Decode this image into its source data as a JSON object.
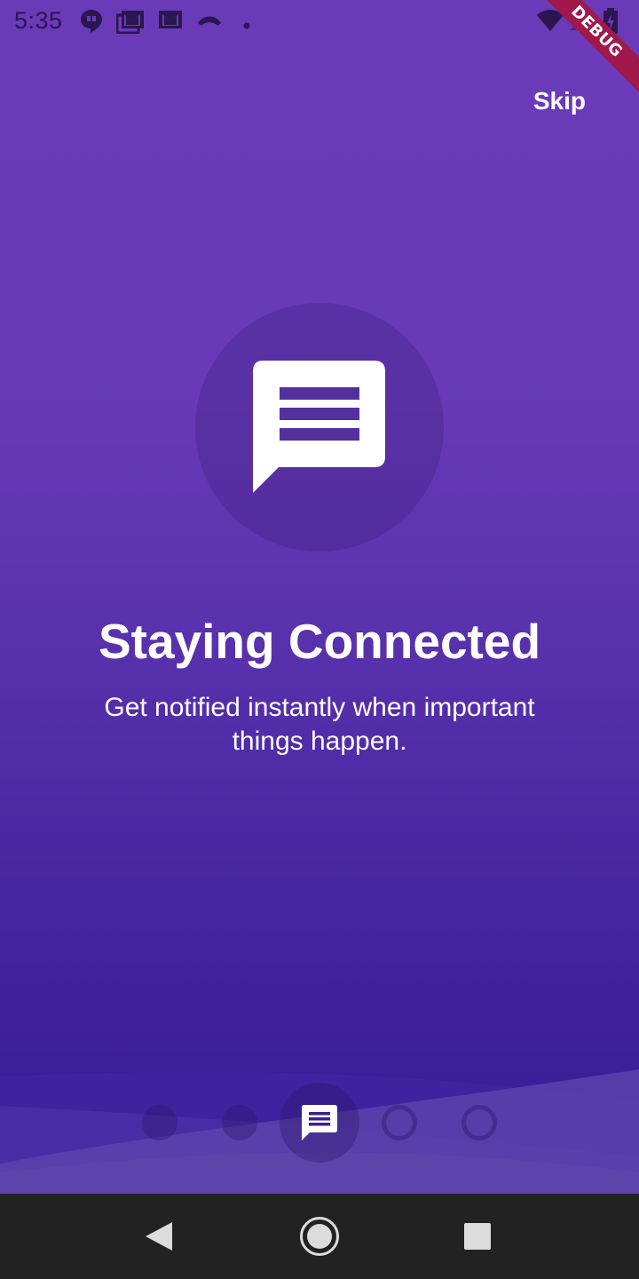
{
  "status_bar": {
    "time": "5:35",
    "left_icons": [
      "hangouts-icon",
      "gmail-stack-icon",
      "gmail-icon",
      "missed-call-icon",
      "dot-icon"
    ],
    "right_icons": [
      "wifi-icon",
      "signal-icon",
      "battery-icon"
    ]
  },
  "debug_banner": {
    "label": "DEBUG"
  },
  "onboarding": {
    "skip_label": "Skip",
    "hero_icon": "chat-message-icon",
    "title": "Staying Connected",
    "subtitle": "Get notified instantly when important things happen."
  },
  "pager": {
    "page_count": 5,
    "current_page": 3,
    "active_icon": "chat-message-icon"
  },
  "nav_bar": {
    "buttons": [
      "back-icon",
      "home-icon",
      "recents-icon"
    ]
  },
  "colors": {
    "gradient_top": "#6a3ab9",
    "gradient_bottom": "#2f1791",
    "debug_banner": "#a1184a",
    "nav_bar": "#222222",
    "text": "#ffffff"
  }
}
